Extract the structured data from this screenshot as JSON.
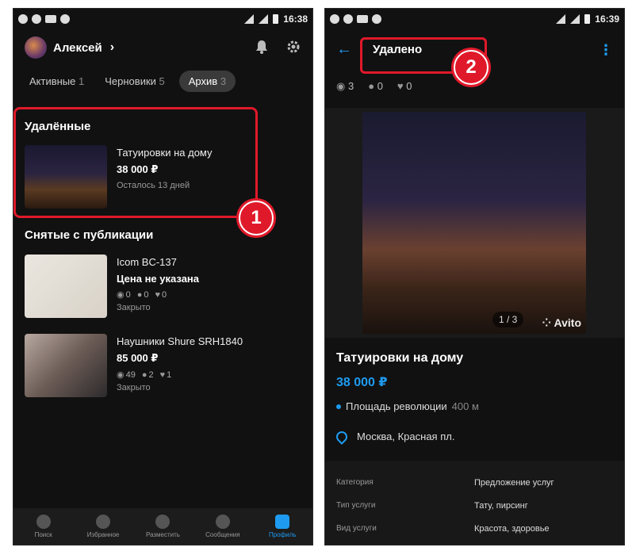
{
  "screen1": {
    "status_time": "16:38",
    "user_name": "Алексей",
    "tabs": [
      {
        "label": "Активные",
        "count": "1"
      },
      {
        "label": "Черновики",
        "count": "5"
      },
      {
        "label": "Архив",
        "count": "3"
      }
    ],
    "deleted_section_title": "Удалённые",
    "deleted_item": {
      "title": "Татуировки на дому",
      "price": "38 000 ₽",
      "note": "Осталось 13 дней"
    },
    "unpublished_section_title": "Снятые с публикации",
    "unpublished_items": [
      {
        "title": "Icom BC-137",
        "price": "Цена не указана",
        "views": "0",
        "contacts": "0",
        "favs": "0",
        "status": "Закрыто"
      },
      {
        "title": "Наушники Shure SRH1840",
        "price": "85 000 ₽",
        "views": "49",
        "contacts": "2",
        "favs": "1",
        "status": "Закрыто"
      }
    ],
    "badge": "1",
    "bottom_nav": [
      "Поиск",
      "Избранное",
      "Разместить",
      "Сообщения",
      "Профиль"
    ]
  },
  "screen2": {
    "status_time": "16:39",
    "title": "Удалено",
    "badge": "2",
    "stats": {
      "views": "3",
      "contacts": "0",
      "favs": "0"
    },
    "pager": "1 / 3",
    "watermark": "Avito",
    "listing_title": "Татуировки на дому",
    "price": "38 000 ₽",
    "metro": "Площадь революции",
    "metro_distance": "400 м",
    "address": "Москва, Красная пл.",
    "params": [
      {
        "key": "Категория",
        "value": "Предложение услуг"
      },
      {
        "key": "Тип услуги",
        "value": "Тату, пирсинг"
      },
      {
        "key": "Вид услуги",
        "value": "Красота, здоровье"
      }
    ]
  },
  "colors": {
    "accent": "#1e9bf0",
    "highlight": "#e0192a",
    "background": "#111111"
  }
}
